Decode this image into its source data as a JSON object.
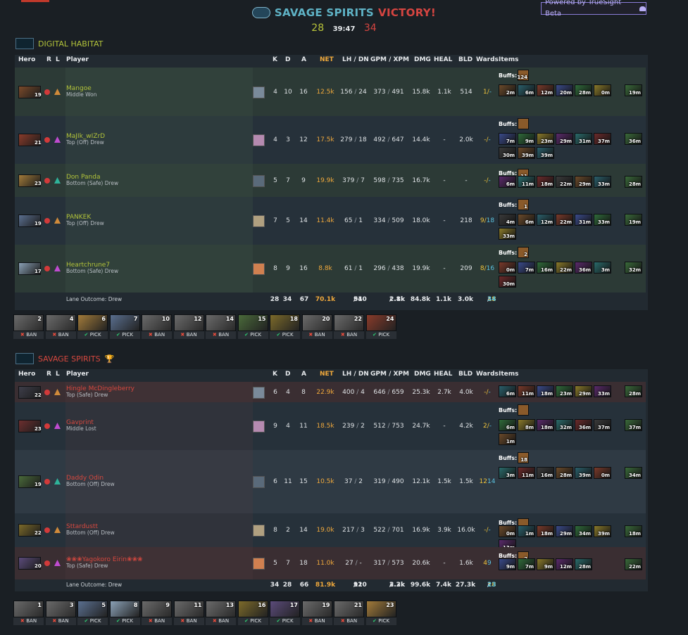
{
  "header": {
    "winner": "SAVAGE SPIRITS",
    "result": "VICTORY!",
    "score_left": "28",
    "duration": "39:47",
    "score_right": "34",
    "powered_by": "Powered by TrueSight Beta"
  },
  "columns": {
    "hero": "Hero",
    "r": "R",
    "l": "L",
    "player": "Player",
    "k": "K",
    "d": "D",
    "a": "A",
    "net": "NET",
    "lh_dn": "LH / DN",
    "gpm_xpm": "GPM / XPM",
    "dmg": "DMG",
    "heal": "HEAL",
    "bld": "BLD",
    "wards": "Wards",
    "items": "Items",
    "buffs": "Buffs:",
    "lane_outcome_label": "Lane Outcome:"
  },
  "teams": [
    {
      "name": "DIGITAL HABITAT",
      "lane_outcome": "Drew",
      "totals": {
        "k": "28",
        "d": "34",
        "a": "67",
        "net": "70.1k",
        "lh": "940",
        "dn": "51",
        "gpm": "2.1k",
        "xpm": "2.8k",
        "dmg": "84.8k",
        "heal": "1.1k",
        "bld": "3.0k",
        "obs": "18",
        "sen": "34"
      },
      "players": [
        {
          "name": "Mangoe",
          "lane": "Middle Won",
          "level": "19",
          "k": "4",
          "d": "10",
          "a": "16",
          "net": "12.5k",
          "lh": "156",
          "dn": "24",
          "gpm": "373",
          "xpm": "491",
          "dmg": "15.8k",
          "heal": "1.1k",
          "bld": "514",
          "obs": "1/",
          "sen": "-",
          "buff_count": "124",
          "items": [
            "2m",
            "6m",
            "12m",
            "20m",
            "28m",
            "0m"
          ],
          "neutral": "19m"
        },
        {
          "name": "MaJIk_wIZrD",
          "lane": "Top (Off) Drew",
          "level": "21",
          "k": "4",
          "d": "3",
          "a": "12",
          "net": "17.5k",
          "lh": "279",
          "dn": "18",
          "gpm": "492",
          "xpm": "647",
          "dmg": "14.4k",
          "heal": "-",
          "bld": "2.0k",
          "obs": "-/",
          "sen": "-",
          "buff_count": "",
          "items": [
            "7m",
            "9m",
            "23m",
            "29m",
            "31m",
            "37m",
            "30m",
            "39m",
            "39m"
          ],
          "neutral": "36m"
        },
        {
          "name": "Don Panda",
          "lane": "Bottom (Safe) Drew",
          "level": "23",
          "k": "5",
          "d": "7",
          "a": "9",
          "net": "19.9k",
          "lh": "379",
          "dn": "7",
          "gpm": "598",
          "xpm": "735",
          "dmg": "16.7k",
          "heal": "-",
          "bld": "-",
          "obs": "-/",
          "sen": "-",
          "buff_count": "11",
          "items": [
            "6m",
            "11m",
            "18m",
            "22m",
            "29m",
            "33m"
          ],
          "neutral": "28m"
        },
        {
          "name": "PANKEK",
          "lane": "Top (Off) Drew",
          "level": "19",
          "k": "7",
          "d": "5",
          "a": "14",
          "net": "11.4k",
          "lh": "65",
          "dn": "1",
          "gpm": "334",
          "xpm": "509",
          "dmg": "18.0k",
          "heal": "-",
          "bld": "218",
          "obs": "9/",
          "sen": "18",
          "buff_count": "1",
          "items": [
            "4m",
            "6m",
            "12m",
            "22m",
            "31m",
            "33m",
            "33m"
          ],
          "neutral": "19m"
        },
        {
          "name": "Heartchrune7",
          "lane": "Bottom (Safe) Drew",
          "level": "17",
          "k": "8",
          "d": "9",
          "a": "16",
          "net": "8.8k",
          "lh": "61",
          "dn": "1",
          "gpm": "296",
          "xpm": "438",
          "dmg": "19.9k",
          "heal": "-",
          "bld": "209",
          "obs": "8/",
          "sen": "16",
          "buff_count": "2",
          "items": [
            "0m",
            "7m",
            "16m",
            "22m",
            "36m",
            "3m",
            "30m"
          ],
          "neutral": "32m"
        }
      ],
      "draft": [
        {
          "n": "2",
          "t": "BAN"
        },
        {
          "n": "4",
          "t": "BAN"
        },
        {
          "n": "6",
          "t": "PICK"
        },
        {
          "n": "7",
          "t": "PICK"
        },
        {
          "n": "10",
          "t": "BAN"
        },
        {
          "n": "12",
          "t": "BAN"
        },
        {
          "n": "14",
          "t": "BAN"
        },
        {
          "n": "15",
          "t": "PICK"
        },
        {
          "n": "18",
          "t": "PICK"
        },
        {
          "n": "20",
          "t": "BAN"
        },
        {
          "n": "22",
          "t": "BAN"
        },
        {
          "n": "24",
          "t": "PICK"
        }
      ]
    },
    {
      "name": "SAVAGE SPIRITS",
      "lane_outcome": "Drew",
      "totals": {
        "k": "34",
        "d": "28",
        "a": "66",
        "net": "81.9k",
        "lh": "920",
        "dn": "11",
        "gpm": "2.3k",
        "xpm": "3.2k",
        "dmg": "99.6k",
        "heal": "7.4k",
        "bld": "27.3k",
        "obs": "18",
        "sen": "23"
      },
      "players": [
        {
          "name": "Hingle McDingleberry",
          "lane": "Top (Safe) Drew",
          "level": "22",
          "k": "6",
          "d": "4",
          "a": "8",
          "net": "22.9k",
          "lh": "400",
          "dn": "4",
          "gpm": "646",
          "xpm": "659",
          "dmg": "25.3k",
          "heal": "2.7k",
          "bld": "4.0k",
          "obs": "-/",
          "sen": "-",
          "buff_count": "",
          "items": [
            "6m",
            "11m",
            "18m",
            "23m",
            "29m",
            "33m"
          ],
          "neutral": "28m"
        },
        {
          "name": "Gavprint",
          "lane": "Middle Lost",
          "level": "23",
          "k": "9",
          "d": "4",
          "a": "11",
          "net": "18.5k",
          "lh": "239",
          "dn": "2",
          "gpm": "512",
          "xpm": "753",
          "dmg": "24.7k",
          "heal": "-",
          "bld": "4.2k",
          "obs": "2/",
          "sen": "-",
          "buff_count": "",
          "items": [
            "6m",
            "8m",
            "18m",
            "32m",
            "36m",
            "37m",
            "1m"
          ],
          "neutral": "37m"
        },
        {
          "name": "Daddy Odin",
          "lane": "Bottom (Off) Drew",
          "level": "19",
          "k": "6",
          "d": "11",
          "a": "15",
          "net": "10.5k",
          "lh": "37",
          "dn": "2",
          "gpm": "319",
          "xpm": "490",
          "dmg": "12.1k",
          "heal": "1.5k",
          "bld": "1.5k",
          "obs": "12",
          "sen": "14",
          "buff_count": "18",
          "items": [
            "3m",
            "11m",
            "16m",
            "28m",
            "39m",
            "0m"
          ],
          "neutral": "34m"
        },
        {
          "name": "Sttardustt",
          "lane": "Bottom (Off) Drew",
          "level": "22",
          "k": "8",
          "d": "2",
          "a": "14",
          "net": "19.0k",
          "lh": "217",
          "dn": "3",
          "gpm": "522",
          "xpm": "701",
          "dmg": "16.9k",
          "heal": "3.9k",
          "bld": "16.0k",
          "obs": "-/",
          "sen": "-",
          "buff_count": "",
          "items": [
            "0m",
            "1m",
            "18m",
            "29m",
            "34m",
            "39m",
            "13m"
          ],
          "neutral": "18m"
        },
        {
          "name": "❀❀❀Yagokoro Eirin❀❀❀",
          "lane": "Top (Safe) Drew",
          "level": "20",
          "k": "5",
          "d": "7",
          "a": "18",
          "net": "11.0k",
          "lh": "27",
          "dn": "-",
          "gpm": "317",
          "xpm": "573",
          "dmg": "20.6k",
          "heal": "-",
          "bld": "1.6k",
          "obs": "4",
          "sen": "9",
          "buff_count": "2",
          "items": [
            "9m",
            "7m",
            "9m",
            "12m",
            "28m"
          ],
          "neutral": "22m"
        }
      ],
      "draft": [
        {
          "n": "1",
          "t": "BAN"
        },
        {
          "n": "3",
          "t": "BAN"
        },
        {
          "n": "5",
          "t": "PICK"
        },
        {
          "n": "8",
          "t": "PICK"
        },
        {
          "n": "9",
          "t": "BAN"
        },
        {
          "n": "11",
          "t": "BAN"
        },
        {
          "n": "13",
          "t": "BAN"
        },
        {
          "n": "16",
          "t": "PICK"
        },
        {
          "n": "17",
          "t": "PICK"
        },
        {
          "n": "19",
          "t": "BAN"
        },
        {
          "n": "21",
          "t": "BAN"
        },
        {
          "n": "23",
          "t": "PICK"
        }
      ]
    }
  ],
  "colors": {
    "radiant": "#b2c33a",
    "dire": "#d6483f",
    "net": "#f0a93c",
    "panel": "#222a31"
  }
}
